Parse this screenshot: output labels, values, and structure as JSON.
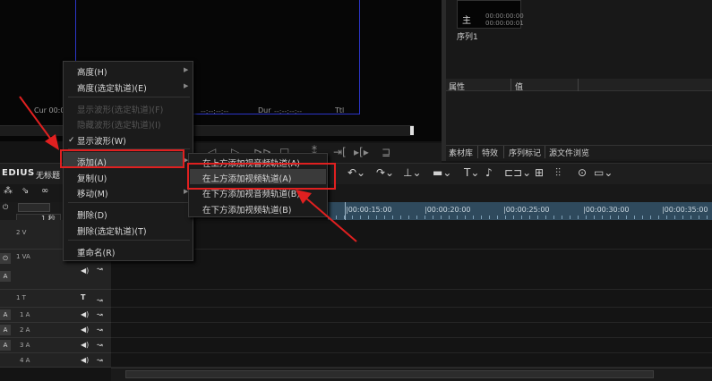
{
  "player": {
    "timecode_cur": "Cur 00:00:",
    "timecode_dots": "--:--:--:--",
    "timecode_dur": "Dur",
    "timecode_ttl": "Ttl"
  },
  "bin": {
    "thumb_tc_in": "00:00:00:00",
    "thumb_tc_out": "00:00:00:01",
    "clip_label": "序列1"
  },
  "properties": {
    "col_property": "属性",
    "col_value": "值"
  },
  "bin_tabs": [
    "素材库",
    "特效",
    "序列标记",
    "源文件浏览"
  ],
  "timeline": {
    "app_name": "EDIUS",
    "project_name": "无标题",
    "zoom_label": "1 秒",
    "ruler_labels": [
      "|00:00:15:00",
      "|00:00:20:00",
      "|00:00:25:00",
      "|00:00:30:00",
      "|00:00:35:00"
    ]
  },
  "tracks": [
    {
      "name": "2 V"
    },
    {
      "name": "1 VA"
    },
    {
      "name": "1 T"
    },
    {
      "name": "1 A"
    },
    {
      "name": "2 A"
    },
    {
      "name": "3 A"
    },
    {
      "name": "4 A"
    }
  ],
  "context_menu": {
    "items": [
      {
        "label": "高度(H)",
        "disabled": false,
        "submenu": true
      },
      {
        "label": "高度(选定轨道)(E)",
        "disabled": false,
        "submenu": true
      },
      {
        "label": "显示波形(选定轨道)(F)",
        "disabled": true,
        "submenu": false
      },
      {
        "label": "隐藏波形(选定轨道)(I)",
        "disabled": true,
        "submenu": false
      },
      {
        "label": "显示波形(W)",
        "disabled": false,
        "checked": true,
        "submenu": false
      },
      {
        "label": "添加(A)",
        "disabled": false,
        "submenu": true,
        "highlighted": true
      },
      {
        "label": "复制(U)",
        "disabled": false,
        "submenu": false
      },
      {
        "label": "移动(M)",
        "disabled": false,
        "submenu": true
      },
      {
        "label": "删除(D)",
        "disabled": false,
        "submenu": false
      },
      {
        "label": "删除(选定轨道)(T)",
        "disabled": false,
        "submenu": false
      },
      {
        "label": "重命名(R)",
        "disabled": false,
        "submenu": false
      }
    ]
  },
  "submenu": {
    "items": [
      {
        "label": "在上方添加视音频轨道(A)"
      },
      {
        "label": "在上方添加视频轨道(A)",
        "highlighted": true
      },
      {
        "label": "在下方添加视音频轨道(B)"
      },
      {
        "label": "在下方添加视频轨道(B)"
      }
    ]
  },
  "colors": {
    "annotation": "#e02020",
    "ruler_bg": "#2f4a5d",
    "player_frame": "#2b35c8"
  }
}
